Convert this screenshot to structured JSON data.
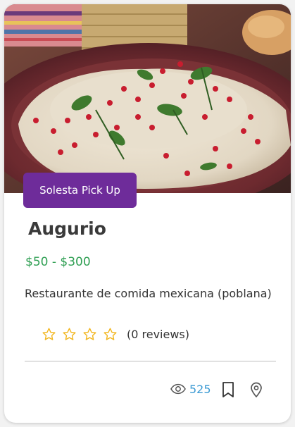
{
  "card": {
    "badge": "Solesta Pick Up",
    "title": "Augurio",
    "price_range": "$50 - $300",
    "description": "Restaurante de comida mexicana (poblana)",
    "rating": {
      "stars_filled": 0,
      "stars_total": 4
    },
    "reviews_text": "(0 reviews)",
    "views": "525",
    "image_alt": "Chiles en nogada con granada y perejil"
  },
  "icons": [
    "eye-icon",
    "bookmark-icon",
    "map-pin-icon",
    "star-outline-icon"
  ],
  "colors": {
    "badge_bg": "#6e2c9a",
    "price": "#2f9f53",
    "star": "#f2b51c",
    "views": "#3d9bd4"
  }
}
